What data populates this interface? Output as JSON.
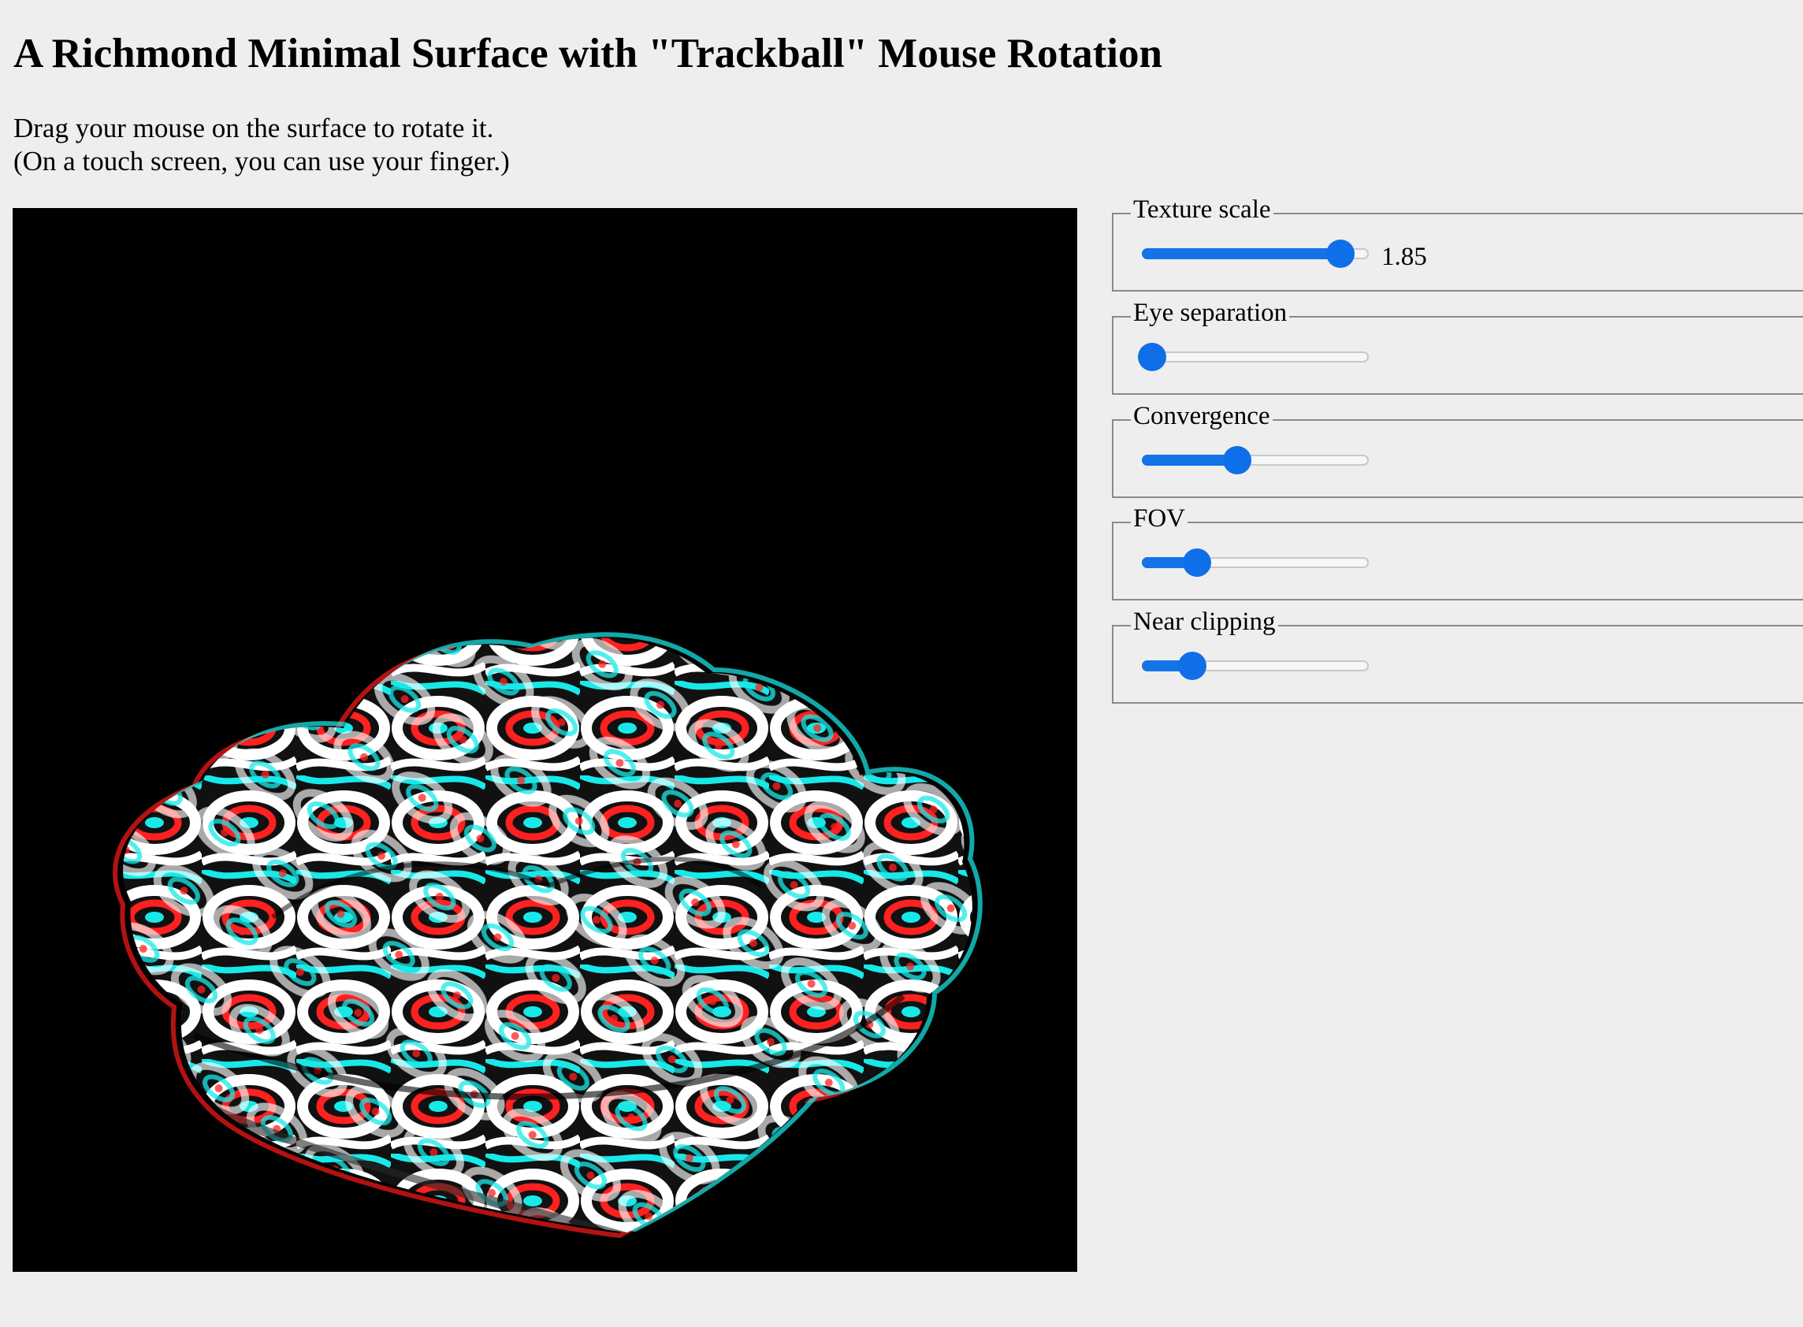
{
  "title": "A Richmond Minimal Surface with \"Trackball\" Mouse Rotation",
  "instructions": {
    "line1": "Drag your mouse on the surface to rotate it.",
    "line2": "(On a touch screen, you can use your finger.)"
  },
  "controls": [
    {
      "label": "Texture scale",
      "level": 0.88,
      "value": "1.85"
    },
    {
      "label": "Eye separation",
      "level": 0.04,
      "value": ""
    },
    {
      "label": "Convergence",
      "level": 0.42,
      "value": ""
    },
    {
      "label": "FOV",
      "level": 0.24,
      "value": ""
    },
    {
      "label": "Near clipping",
      "level": 0.22,
      "value": ""
    }
  ],
  "colors": {
    "accent": "#1473e6",
    "background": "#eeeeee",
    "canvas": "#000000",
    "anaglyph_red": "#ff1a1a",
    "anaglyph_cyan": "#19f0f0"
  }
}
